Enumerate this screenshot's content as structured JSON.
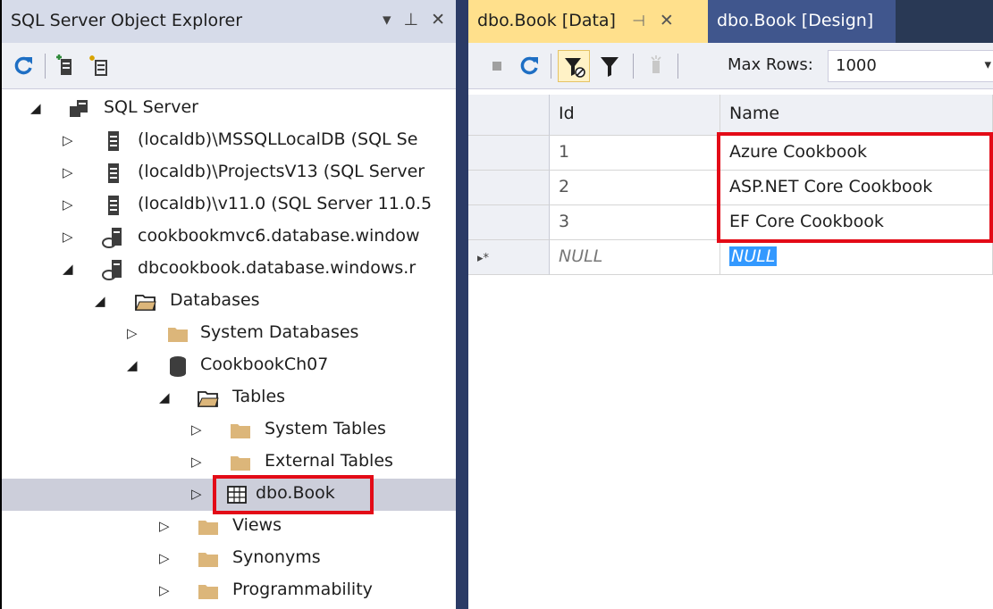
{
  "explorer": {
    "title": "SQL Server Object Explorer",
    "title_buttons": [
      "▾",
      "⊥",
      "✕"
    ],
    "toolbar": [
      "refresh-icon",
      "add-sql-server-icon",
      "add-connection-icon"
    ],
    "tree": [
      {
        "label": "SQL Server",
        "arrow": "◢",
        "icon": "server-group-icon"
      },
      {
        "label": "(localdb)\\MSSQLLocalDB (SQL Se",
        "arrow": "▷",
        "icon": "server-icon"
      },
      {
        "label": "(localdb)\\ProjectsV13 (SQL Server",
        "arrow": "▷",
        "icon": "server-icon"
      },
      {
        "label": "(localdb)\\v11.0 (SQL Server 11.0.5",
        "arrow": "▷",
        "icon": "server-icon"
      },
      {
        "label": "cookbookmvc6.database.window",
        "arrow": "▷",
        "icon": "azure-server-icon"
      },
      {
        "label": "dbcookbook.database.windows.r",
        "arrow": "◢",
        "icon": "azure-server-icon"
      },
      {
        "label": "Databases",
        "arrow": "◢",
        "icon": "folder-open-icon"
      },
      {
        "label": "System Databases",
        "arrow": "▷",
        "icon": "folder-icon"
      },
      {
        "label": "CookbookCh07",
        "arrow": "◢",
        "icon": "database-icon"
      },
      {
        "label": "Tables",
        "arrow": "◢",
        "icon": "folder-open-icon"
      },
      {
        "label": "System Tables",
        "arrow": "▷",
        "icon": "folder-icon"
      },
      {
        "label": "External Tables",
        "arrow": "▷",
        "icon": "folder-icon"
      },
      {
        "label": "dbo.Book",
        "arrow": "▷",
        "icon": "table-icon"
      },
      {
        "label": "Views",
        "arrow": "▷",
        "icon": "folder-icon"
      },
      {
        "label": "Synonyms",
        "arrow": "▷",
        "icon": "folder-icon"
      },
      {
        "label": "Programmability",
        "arrow": "▷",
        "icon": "folder-icon"
      }
    ]
  },
  "editor": {
    "tabs": [
      {
        "label": "dbo.Book [Data]",
        "pin": "⊣",
        "close": "✕"
      },
      {
        "label": "dbo.Book [Design]"
      }
    ],
    "toolbar": {
      "icons": [
        "stop-icon",
        "refresh-icon",
        "filter-active-icon",
        "filter-icon",
        "script-icon"
      ],
      "max_rows_label": "Max Rows:",
      "max_rows_value": "1000"
    },
    "grid": {
      "columns": [
        "Id",
        "Name"
      ],
      "rows": [
        {
          "id": "1",
          "name": "Azure Cookbook"
        },
        {
          "id": "2",
          "name": "ASP.NET Core Cookbook"
        },
        {
          "id": "3",
          "name": "EF Core Cookbook"
        }
      ],
      "new_row": {
        "marker": "▸*",
        "id": "NULL",
        "name": "NULL"
      }
    }
  },
  "colors": {
    "accent_tab": "#ffe08c",
    "tabstrip": "#293955",
    "highlight_box": "#e30b17",
    "selection": "#3399ff"
  }
}
